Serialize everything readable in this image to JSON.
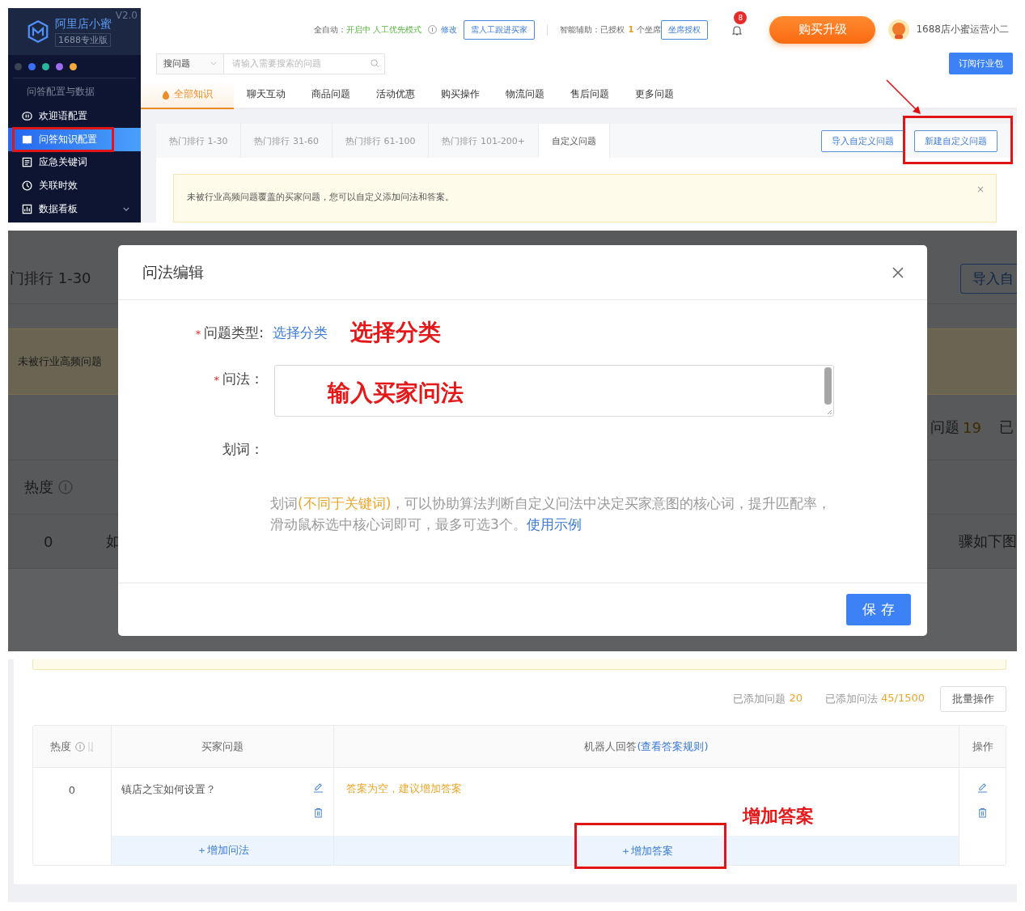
{
  "top_screen": {
    "sidebar": {
      "title": "阿里店小蜜",
      "edition": "1688专业版",
      "version": "V2.0",
      "dots": [
        {
          "color": "#3d4352"
        },
        {
          "color": "#3b6ff5"
        },
        {
          "color": "#27b59c"
        },
        {
          "color": "#9d6cf0"
        },
        {
          "color": "#f5a93a"
        }
      ],
      "section": "问答配置与数据",
      "items": [
        {
          "label": "欢迎语配置",
          "selected": false
        },
        {
          "label": "问答知识配置",
          "selected": true
        },
        {
          "label": "应急关键词",
          "selected": false
        },
        {
          "label": "关联时效",
          "selected": false
        },
        {
          "label": "数据看板",
          "selected": false
        }
      ]
    },
    "header": {
      "auto_label": "全自动：",
      "auto_status": "开启中",
      "auto_mode": "人工优先模式",
      "edit_link": "修改",
      "follow_button": "需人工跟进买家",
      "assist_label": "智能辅助：已授权",
      "assist_count": "1",
      "assist_unit": "个坐席",
      "seat_button": "坐席授权",
      "notification_count": "8",
      "upgrade_button": "购买升级",
      "user_name": "1688店小蜜运营小二",
      "subscribe_button": "订阅行业包"
    },
    "search": {
      "scope": "搜问题",
      "placeholder": "请输入需要搜索的问题"
    },
    "category_tabs": [
      {
        "label": "全部知识",
        "selected": true
      },
      {
        "label": "聊天互动",
        "selected": false
      },
      {
        "label": "商品问题",
        "selected": false
      },
      {
        "label": "活动优惠",
        "selected": false
      },
      {
        "label": "购买操作",
        "selected": false
      },
      {
        "label": "物流问题",
        "selected": false
      },
      {
        "label": "售后问题",
        "selected": false
      },
      {
        "label": "更多问题",
        "selected": false
      }
    ],
    "rank_tabs": [
      {
        "label": "热门排行 1-30",
        "selected": false
      },
      {
        "label": "热门排行 31-60",
        "selected": false
      },
      {
        "label": "热门排行 61-100",
        "selected": false
      },
      {
        "label": "热门排行 101-200+",
        "selected": false
      },
      {
        "label": "自定义问题",
        "selected": true
      }
    ],
    "import_button": "导入自定义问题",
    "new_button": "新建自定义问题",
    "notice": "未被行业高频问题覆盖的买家问题，您可以自定义添加问法和答案。",
    "notice_close": "×"
  },
  "modal_screen": {
    "background": {
      "rank_tab": "门排行 1-30",
      "import_button": "导入自",
      "notice": "未被行业高频问题",
      "stats_label": "问题",
      "stats_value": "19",
      "stats_next": "已",
      "column": "热度",
      "row_value": "0",
      "row_text": "如",
      "row_text_right": "骤如下图"
    },
    "dialog": {
      "title": "问法编辑",
      "type_required": "*",
      "question_required": "*",
      "type_label": "问题类型:",
      "type_link": "选择分类",
      "type_annotation": "选择分类",
      "question_label": "问法：",
      "question_annotation": "输入买家问法",
      "mark_label": "划词：",
      "hint": [
        {
          "kind": "plain",
          "text": "划词"
        },
        {
          "kind": "highlight",
          "text": "(不同于关键词)"
        },
        {
          "kind": "plain",
          "text": "，可以协助算法判断自定义问法中决定买家意图的核心词，提升匹配率，滑动鼠标选中核心词即可，最多可选3个。"
        }
      ],
      "hint_link": "使用示例",
      "save_button": "保 存"
    }
  },
  "table_screen": {
    "stats": [
      {
        "label": "已添加问题",
        "value": "20"
      },
      {
        "label": "已添加问法",
        "value": "45/1500"
      }
    ],
    "batch_button": "批量操作",
    "columns": [
      "热度",
      "买家问题",
      "机器人回答",
      "操作"
    ],
    "answer_rule_link": "(查看答案规则)",
    "rows": [
      {
        "heat": "0",
        "question": "镇店之宝如何设置？",
        "answer": "答案为空，建议增加答案",
        "add_question": "＋增加问法",
        "add_answer": "＋增加答案"
      }
    ],
    "annotation": "增加答案"
  }
}
